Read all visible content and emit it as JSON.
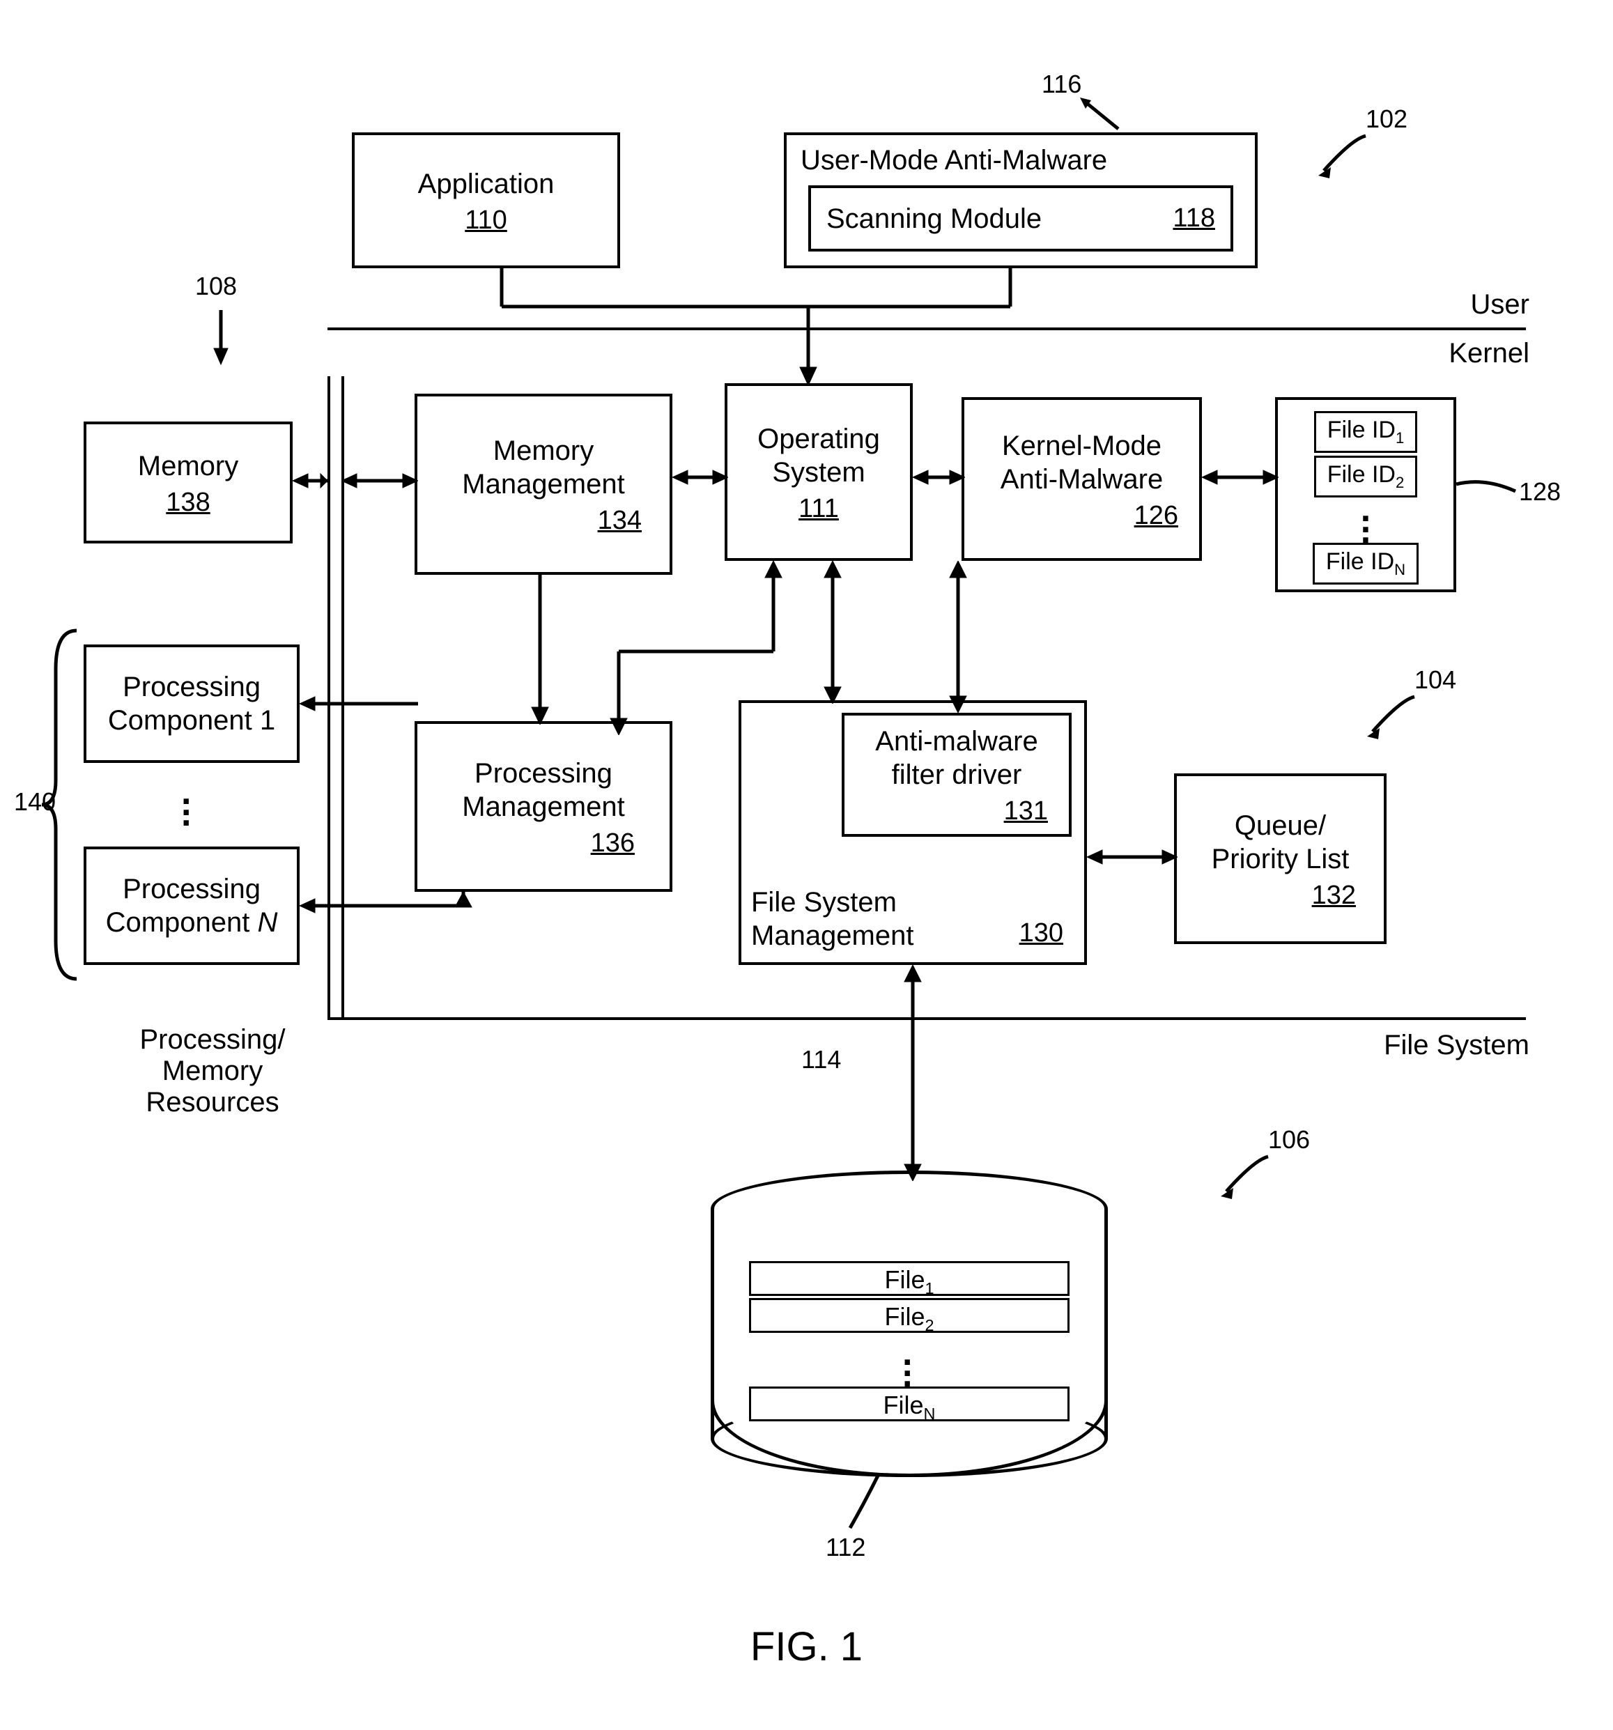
{
  "figure_caption": "FIG. 1",
  "tiers": {
    "user": "User",
    "kernel": "Kernel",
    "file_system": "File System",
    "resources": "Processing/\nMemory\nResources"
  },
  "callouts": {
    "user_tier": "102",
    "kernel_tier": "104",
    "file_system_tier": "106",
    "resources": "108",
    "files": "112",
    "fs_divider": "114",
    "user_anti_malware": "116",
    "scanning_module": "118",
    "application": "110",
    "operating_system": "111",
    "memory": "138",
    "memory_mgmt": "134",
    "processing_mgmt": "136",
    "processing_components": "140",
    "kernel_anti_malware": "126",
    "file_ids": "128",
    "file_system_mgmt": "130",
    "filter_driver": "131",
    "queue": "132"
  },
  "boxes": {
    "application": {
      "label": "Application",
      "ref": "110"
    },
    "user_anti_malware": {
      "label": "User-Mode Anti-Malware"
    },
    "scanning_module": {
      "label": "Scanning Module",
      "ref": "118"
    },
    "memory": {
      "label": "Memory",
      "ref": "138"
    },
    "memory_mgmt": {
      "label": "Memory\nManagement",
      "ref": "134"
    },
    "operating_system": {
      "label": "Operating\nSystem",
      "ref": "111"
    },
    "kernel_anti_malware": {
      "label": "Kernel-Mode\nAnti-Malware",
      "ref": "126"
    },
    "file_ids": {
      "rows": [
        "File ID",
        "File ID",
        "File ID"
      ],
      "subs": [
        "1",
        "2",
        "N"
      ]
    },
    "processing_components": {
      "top": "Processing\nComponent 1",
      "bottom_prefix": "Processing\nComponent ",
      "bottom_suffix": "N"
    },
    "processing_mgmt": {
      "label": "Processing\nManagement",
      "ref": "136"
    },
    "file_system_mgmt": {
      "label": "File System\nManagement",
      "ref": "130"
    },
    "filter_driver": {
      "label": "Anti-malware\nfilter driver",
      "ref": "131"
    },
    "queue": {
      "label": "Queue/\nPriority List",
      "ref": "132"
    }
  },
  "files": {
    "rows": [
      "File",
      "File",
      "File"
    ],
    "subs": [
      "1",
      "2",
      "N"
    ]
  }
}
